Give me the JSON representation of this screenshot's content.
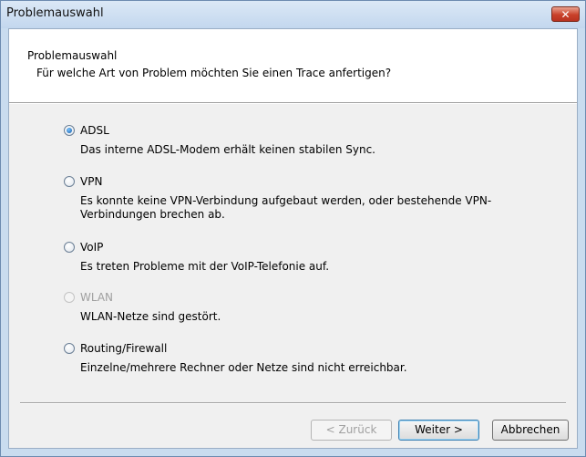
{
  "window": {
    "title": "Problemauswahl",
    "close_label": "✕"
  },
  "header": {
    "title": "Problemauswahl",
    "subtitle": "Für welche Art von Problem möchten Sie einen Trace anfertigen?"
  },
  "options": [
    {
      "label": "ADSL",
      "description": "Das interne ADSL-Modem erhält keinen stabilen Sync.",
      "checked": true,
      "disabled": false
    },
    {
      "label": "VPN",
      "description": "Es konnte keine VPN-Verbindung aufgebaut werden, oder bestehende VPN-Verbindungen brechen ab.",
      "checked": false,
      "disabled": false
    },
    {
      "label": "VoIP",
      "description": "Es treten Probleme mit der VoIP-Telefonie auf.",
      "checked": false,
      "disabled": false
    },
    {
      "label": "WLAN",
      "description": "WLAN-Netze sind gestört.",
      "checked": false,
      "disabled": true
    },
    {
      "label": "Routing/Firewall",
      "description": "Einzelne/mehrere Rechner oder Netze sind nicht erreichbar.",
      "checked": false,
      "disabled": false
    }
  ],
  "buttons": {
    "back": "< Zurück",
    "next": "Weiter >",
    "cancel": "Abbrechen"
  }
}
